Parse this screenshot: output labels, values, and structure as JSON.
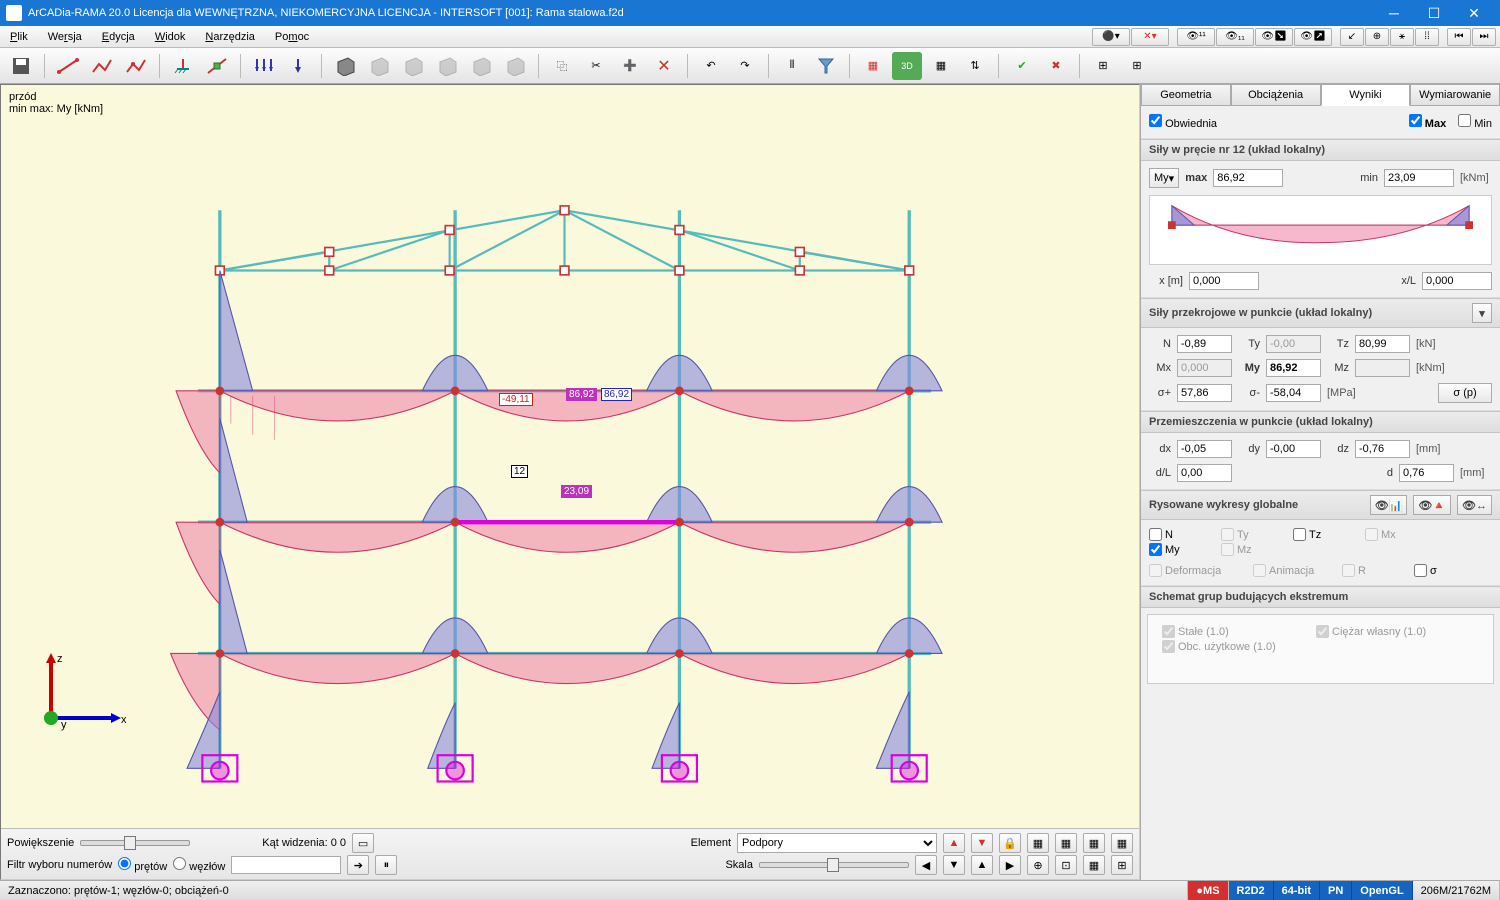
{
  "window": {
    "title": "ArCADia-RAMA 20.0 Licencja dla WEWNĘTRZNA, NIEKOMERCYJNA LICENCJA - INTERSOFT [001]: Rama stalowa.f2d"
  },
  "menu": {
    "plik": "Plik",
    "wersja": "Wersja",
    "edycja": "Edycja",
    "widok": "Widok",
    "narzedzia": "Narzędzia",
    "pomoc": "Pomoc"
  },
  "viewport": {
    "label_top": "przód",
    "label_minmax": "min max: My [kNm]",
    "axis_x": "x",
    "axis_y": "y",
    "axis_z": "z"
  },
  "annotations": {
    "v1": "-49,11",
    "v2": "86,92",
    "v3": "86,92",
    "v4": "23,09",
    "elem": "12"
  },
  "vp_footer": {
    "powiekszenie": "Powiększenie",
    "kat": "Kąt widzenia: 0 0",
    "filtr": "Filtr wyboru numerów",
    "pretow": "prętów",
    "wezlow": "węzłów",
    "element": "Element",
    "skala": "Skala",
    "element_sel": "Podpory"
  },
  "side": {
    "tabs": {
      "geo": "Geometria",
      "obc": "Obciążenia",
      "wyn": "Wyniki",
      "wym": "Wymiarowanie"
    },
    "obwiednia": "Obwiednia",
    "max": "Max",
    "min": "Min",
    "sily_header": "Siły w pręcie nr 12 (układ lokalny)",
    "max_lbl": "max",
    "max_val": "86,92",
    "min_lbl": "min",
    "min_val": "23,09",
    "unit_knm": "[kNm]",
    "x_lbl": "x [m]",
    "x_val": "0,000",
    "xl_lbl": "x/L",
    "xl_val": "0,000",
    "przekroj_header": "Siły przekrojowe w punkcie (układ lokalny)",
    "N": "N",
    "N_val": "-0,89",
    "Ty": "Ty",
    "Ty_val": "-0,00",
    "Tz": "Tz",
    "Tz_val": "80,99",
    "unit_kn": "[kN]",
    "Mx": "Mx",
    "Mx_val": "0,000",
    "My": "My",
    "My_val": "86,92",
    "Mz": "Mz",
    "Mz_val": "",
    "unit_knm2": "[kNm]",
    "sp": "σ+",
    "sp_val": "57,86",
    "sm": "σ-",
    "sm_val": "-58,04",
    "unit_mpa": "[MPa]",
    "sigma_btn": "σ (p)",
    "przem_header": "Przemieszczenia w punkcie (układ lokalny)",
    "dx": "dx",
    "dx_val": "-0,05",
    "dy": "dy",
    "dy_val": "-0,00",
    "dz": "dz",
    "dz_val": "-0,76",
    "unit_mm": "[mm]",
    "dL": "d/L",
    "dL_val": "0,00",
    "d": "d",
    "d_val": "0,76",
    "unit_mm2": "[mm]",
    "rys_header": "Rysowane wykresy globalne",
    "cks": {
      "N": "N",
      "Ty": "Ty",
      "Tz": "Tz",
      "Mx": "Mx",
      "My": "My",
      "Mz": "Mz",
      "def": "Deformacja",
      "anim": "Animacja",
      "R": "R",
      "sig": "σ"
    },
    "schemat_header": "Schemat grup budujących ekstremum",
    "g1": "Stałe (1.0)",
    "g2": "Ciężar własny (1.0)",
    "g3": "Obc. użytkowe (1.0)",
    "My_dd": "My"
  },
  "status": {
    "zazn": "Zaznaczono: prętów-1; węzłów-0; obciążeń-0",
    "ms": "MS",
    "r2d2": "R2D2",
    "bit": "64-bit",
    "pn": "PN",
    "ogl": "OpenGL",
    "mem": "206M/21762M"
  }
}
